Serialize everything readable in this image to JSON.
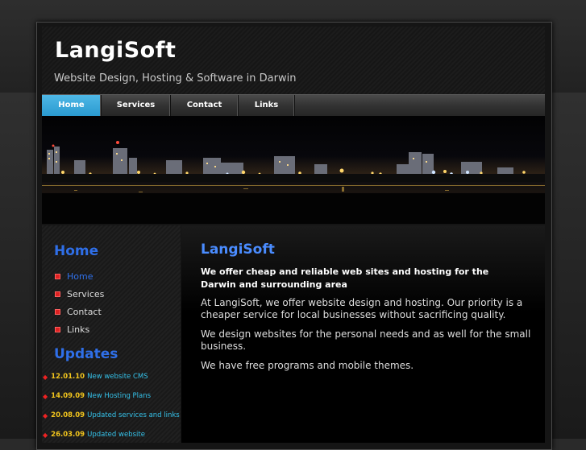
{
  "header": {
    "title": "LangiSoft",
    "subtitle": "Website Design, Hosting & Software in Darwin"
  },
  "nav": {
    "items": [
      {
        "label": "Home",
        "active": true
      },
      {
        "label": "Services",
        "active": false
      },
      {
        "label": "Contact",
        "active": false
      },
      {
        "label": "Links",
        "active": false
      }
    ]
  },
  "sidebar": {
    "heading": "Home",
    "items": [
      {
        "label": "Home",
        "current": true
      },
      {
        "label": "Services",
        "current": false
      },
      {
        "label": "Contact",
        "current": false
      },
      {
        "label": "Links",
        "current": false
      }
    ],
    "updates_heading": "Updates",
    "updates": [
      {
        "date": "12.01.10",
        "text": "New website CMS"
      },
      {
        "date": "14.09.09",
        "text": "New Hosting Plans"
      },
      {
        "date": "20.08.09",
        "text": "Updated services and links"
      },
      {
        "date": "26.03.09",
        "text": "Updated website"
      }
    ]
  },
  "content": {
    "title": "LangiSoft",
    "lead": "We offer cheap and reliable web sites and hosting for the Darwin and surrounding area",
    "paragraphs": [
      "At LangiSoft, we offer website design and hosting. Our priority is a cheaper service for local businesses without sacrificing quality.",
      "We design websites for the personal needs and as well for the small business.",
      "We have free programs and mobile themes."
    ]
  },
  "colors": {
    "accent_blue": "#2f6fe8",
    "nav_active": "#2a9ad0",
    "update_date": "#f2c51d",
    "update_text": "#35c2ea",
    "bullet_red": "#dd2222"
  },
  "icons": {
    "list_bullet": "red-square-bullet-icon",
    "update_bullet": "red-diamond-bullet-icon"
  }
}
